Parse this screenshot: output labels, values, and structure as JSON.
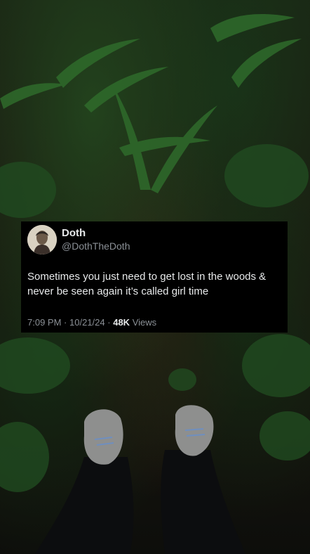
{
  "tweet": {
    "display_name": "Doth",
    "handle": "@DothTheDoth",
    "text": "Sometimes you just need to get lost in the woods & never be seen again it’s called girl time",
    "time": "7:09 PM",
    "date": "10/21/24",
    "separator": "·",
    "views_count": "48K",
    "views_label": "Views"
  },
  "icons": {
    "avatar": "portrait-avatar-icon"
  },
  "colors": {
    "card_background": "#000000",
    "text_primary": "#e7e9ea",
    "text_secondary": "#8b9096",
    "foliage": "#2f6a2a",
    "soil": "#3a2418"
  }
}
